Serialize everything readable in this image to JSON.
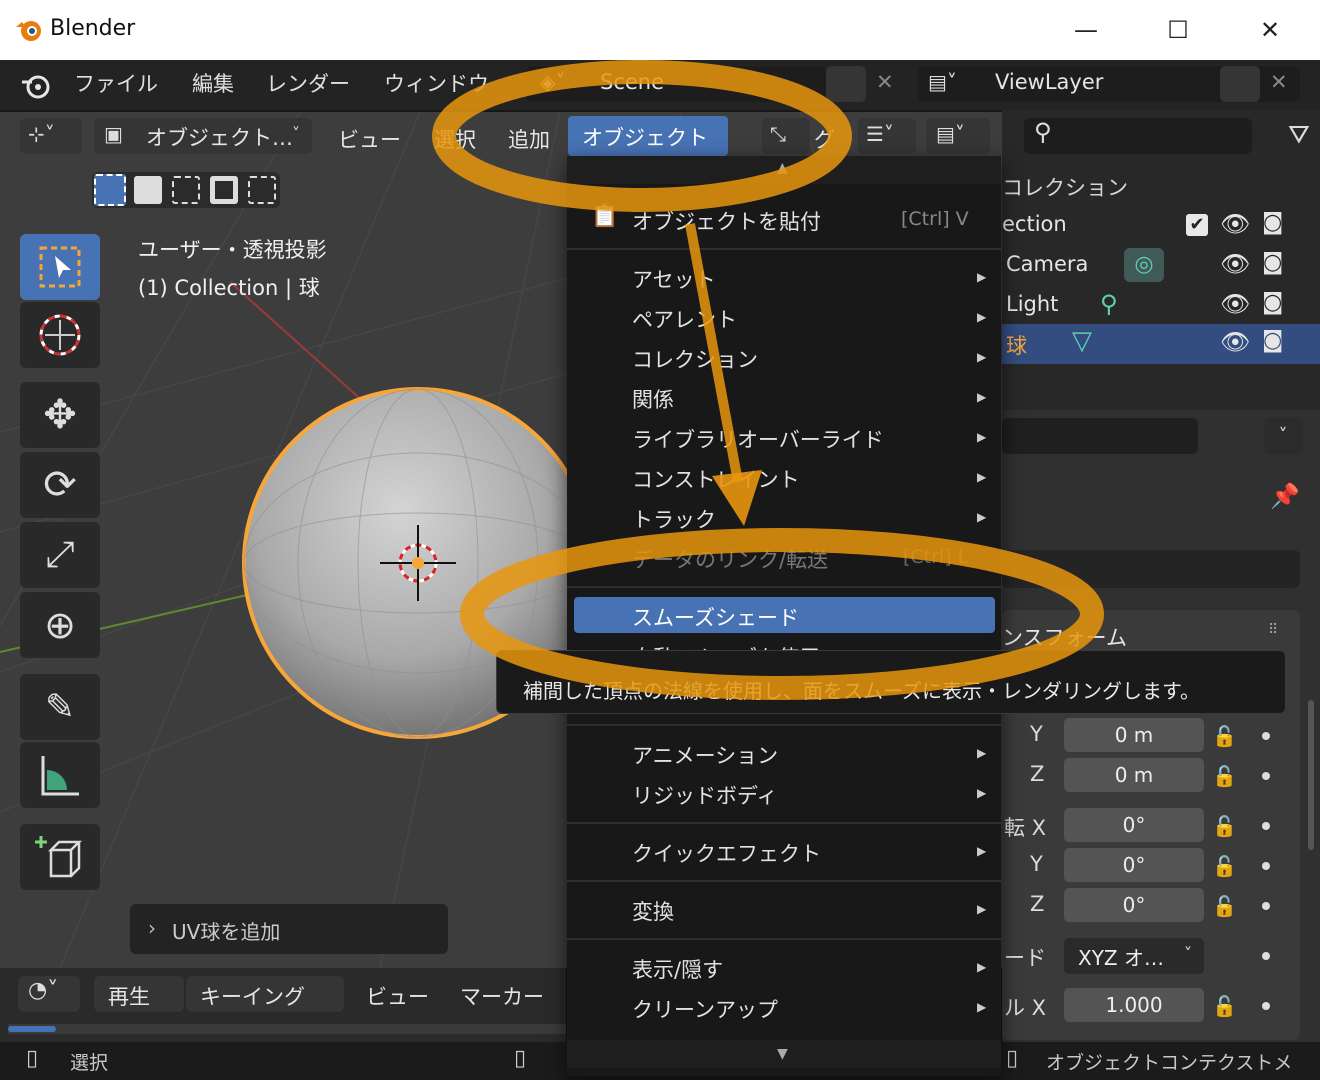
{
  "window": {
    "title": "Blender",
    "minimize": "—",
    "maximize": "☐",
    "close": "✕"
  },
  "topbar": {
    "menus": [
      "ファイル",
      "編集",
      "レンダー",
      "ウィンドウ"
    ],
    "scene": "Scene",
    "view_layer": "ViewLayer"
  },
  "header": {
    "mode": "オブジェクト…",
    "menus": [
      "ビュー",
      "選択",
      "追加",
      "オブジェクト"
    ],
    "active_menu": "オブジェクト",
    "partial_menu": "グ"
  },
  "viewport": {
    "view_name": "ユーザー・透視投影",
    "collection_info": "(1) Collection | 球",
    "operator_panel": "UV球を追加"
  },
  "outliner": {
    "header": "コレクション",
    "rows": [
      {
        "label": "ection",
        "icon": "collection-icon"
      },
      {
        "label": "Camera",
        "icon": "camera-icon"
      },
      {
        "label": "Light",
        "icon": "light-icon"
      },
      {
        "label": "球",
        "icon": "mesh-icon",
        "selected": true
      }
    ]
  },
  "object_menu": {
    "top_arrow": "▲",
    "bottom_arrow": "▼",
    "items": [
      {
        "label": "オブジェクトを貼付",
        "shortcut": "[Ctrl] V",
        "submenu": false
      },
      {
        "label": "アセット",
        "submenu": true
      },
      {
        "label": "ペアレント",
        "submenu": true
      },
      {
        "label": "コレクション",
        "submenu": true
      },
      {
        "label": "関係",
        "submenu": true
      },
      {
        "label": "ライブラリオーバーライド",
        "submenu": true
      },
      {
        "label": "コンストレイント",
        "submenu": true
      },
      {
        "label": "トラック",
        "submenu": true
      },
      {
        "label": "データのリンク/転送",
        "shortcut": "[Ctrl] L",
        "submenu": true
      },
      {
        "label": "スムーズシェード",
        "highlighted": true
      },
      {
        "label": "自動スムーズを使用"
      },
      {
        "label": "アニメーション",
        "submenu": true
      },
      {
        "label": "リジッドボディ",
        "submenu": true
      },
      {
        "label": "クイックエフェクト",
        "submenu": true
      },
      {
        "label": "変換",
        "submenu": true
      },
      {
        "label": "表示/隠す",
        "submenu": true
      },
      {
        "label": "クリーンアップ",
        "submenu": true
      }
    ]
  },
  "tooltip": {
    "text": "補間した頂点の法線を使用し、面をスムーズに表示・レンダリングします。"
  },
  "properties": {
    "section": "ンスフォーム",
    "location": [
      {
        "axis": "Y",
        "value": "0 m"
      },
      {
        "axis": "Z",
        "value": "0 m"
      }
    ],
    "rotation_label": "転 X",
    "rotation": [
      {
        "axis": "Y",
        "value": "0°"
      },
      {
        "axis": "Z",
        "value": "0°"
      }
    ],
    "rotation_x": "0°",
    "mode_label": "ード",
    "mode_value": "XYZ オ…",
    "scale_label": "ル X",
    "scale_x": "1.000"
  },
  "timeline": {
    "menus": [
      "再生",
      "キーイング",
      "ビュー",
      "マーカー"
    ]
  },
  "statusbar": {
    "left": "選択",
    "right": "オブジェクトコンテクストメ"
  },
  "colors": {
    "accent": "#4772b3",
    "annotation": "#e8960e",
    "selection": "#f7a63a"
  }
}
